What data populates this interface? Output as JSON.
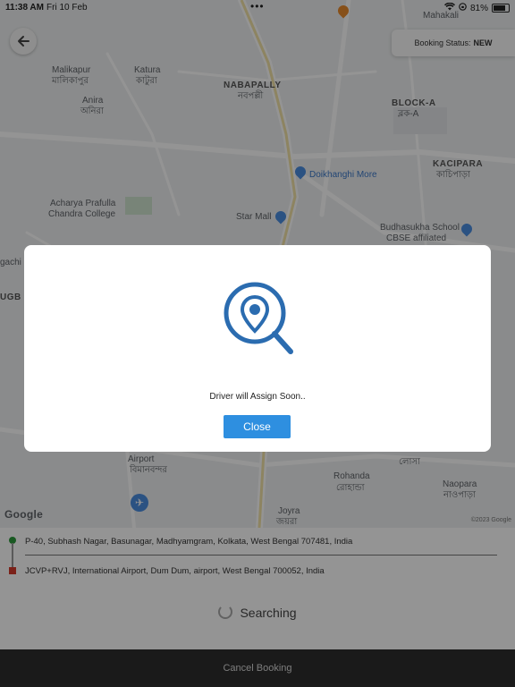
{
  "status_bar": {
    "time": "11:38 AM",
    "date": "Fri 10 Feb",
    "battery": "81%",
    "battery_level": 0.81
  },
  "booking_status": {
    "label": "Booking Status:",
    "value": "NEW"
  },
  "map": {
    "labels": {
      "mahakali": "Mahakali",
      "malikapur_en": "Malikapur",
      "malikapur_bn": "মালিকাপুর",
      "katura_en": "Katura",
      "katura_bn": "কাটুরা",
      "anira_en": "Anira",
      "anira_bn": "অনিরা",
      "nabapally_en": "NABAPALLY",
      "nabapally_bn": "নবপল্লী",
      "block_en": "BLOCK-A",
      "block_bn": "ব্লক-A",
      "kacipara_en": "KACIPARA",
      "kacipara_bn": "কাচিপাড়া",
      "doikhanghi": "Doikhanghi More",
      "star_mall": "Star Mall",
      "achraya_1": "Acharya Prafulla",
      "achraya_2": "Chandra College",
      "budhasukha_1": "Budhasukha School",
      "budhasukha_2": "CBSE affiliated",
      "rohanda_en": "Rohanda",
      "rohanda_bn": "রোহান্ডা",
      "naopara_en": "Naopara",
      "naopara_bn": "নাওপাড়া",
      "joyra_en": "Joyra",
      "joyra_bn": "জয়রা",
      "gachi": "gachi",
      "bengal": "UGB",
      "airport_en": "Airport",
      "airport_bn": "বিমানবন্দর",
      "losa": "লোসা"
    },
    "google": "Google",
    "copyright": "©2023 Google"
  },
  "addresses": {
    "pickup": "P-40, Subhash Nagar, Basunagar, Madhyamgram, Kolkata, West Bengal 707481, India",
    "drop": "JCVP+RVJ, International Airport, Dum Dum, airport, West Bengal 700052, India"
  },
  "searching": "Searching",
  "cancel_button": "Cancel Booking",
  "modal": {
    "message": "Driver will Assign Soon..",
    "close_label": "Close"
  },
  "colors": {
    "primary": "#2e8fe0",
    "icon_blue": "#2b6cb0",
    "pickup": "#2c9a3c",
    "drop": "#d53a2c"
  }
}
